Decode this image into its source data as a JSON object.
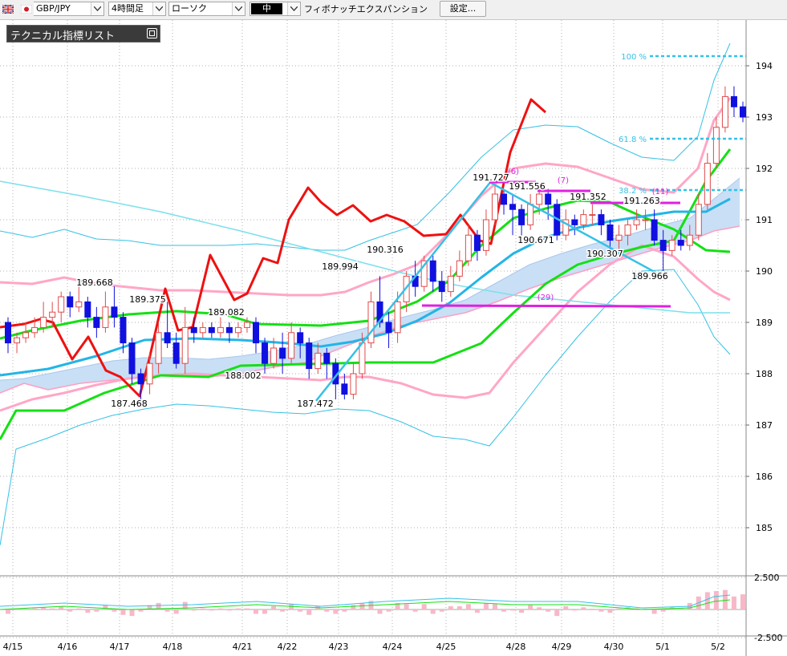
{
  "toolbar": {
    "symbol": "GBP/JPY",
    "timeframe": "4時間足",
    "chart_type": "ローソク",
    "size": "中",
    "analysis": "フィボナッチエクスパンション",
    "settings_label": "設定..."
  },
  "indicator_panel": {
    "title": "テクニカル指標リスト"
  },
  "chart": {
    "price_ticks": [
      "194",
      "193",
      "192",
      "191",
      "190",
      "189",
      "188",
      "187",
      "186",
      "185"
    ],
    "macd_ticks": [
      "2.500",
      "-2.500"
    ],
    "date_labels": [
      "4/15",
      "4/16",
      "4/17",
      "4/18",
      "4/21",
      "4/22",
      "4/23",
      "4/24",
      "4/25",
      "4/28",
      "4/29",
      "4/30",
      "5/1",
      "5/2"
    ],
    "price_annotations": [
      "189.668",
      "189.375",
      "189.082",
      "188.002",
      "187.468",
      "187.472",
      "189.994",
      "190.316",
      "191.727",
      "191.556",
      "190.671",
      "191.352",
      "191.263",
      "190.307",
      "189.966"
    ],
    "fib_levels": [
      "100 %",
      "61.8 %",
      "38.2 %"
    ],
    "wave_labels": [
      "(6)",
      "(7)",
      "(11)",
      "(29)"
    ]
  },
  "chart_data": {
    "type": "candlestick",
    "symbol": "GBP/JPY",
    "interval": "4時間足",
    "y_range": [
      184.3,
      194.6
    ],
    "candles": [
      [
        189.0,
        188.6,
        189.1,
        188.4
      ],
      [
        188.6,
        188.7,
        188.8,
        188.4
      ],
      [
        188.7,
        188.8,
        189.0,
        188.6
      ],
      [
        188.8,
        188.9,
        189.1,
        188.7
      ],
      [
        188.9,
        189.1,
        189.4,
        188.8
      ],
      [
        189.1,
        189.2,
        189.4,
        188.9
      ],
      [
        189.2,
        189.5,
        189.6,
        189.0
      ],
      [
        189.5,
        189.3,
        189.6,
        189.1
      ],
      [
        189.3,
        189.4,
        189.7,
        189.2
      ],
      [
        189.4,
        189.1,
        189.5,
        188.9
      ],
      [
        189.1,
        188.9,
        189.3,
        188.7
      ],
      [
        188.9,
        189.3,
        189.6,
        188.8
      ],
      [
        189.3,
        189.1,
        189.7,
        188.9
      ],
      [
        189.1,
        188.6,
        189.2,
        188.4
      ],
      [
        188.6,
        188.0,
        188.7,
        187.8
      ],
      [
        188.0,
        187.8,
        188.1,
        187.5
      ],
      [
        187.8,
        188.2,
        188.4,
        187.6
      ],
      [
        188.2,
        188.8,
        189.0,
        188.0
      ],
      [
        188.8,
        188.6,
        189.4,
        188.5
      ],
      [
        188.6,
        188.2,
        188.8,
        188.1
      ],
      [
        188.2,
        188.9,
        189.3,
        188.0
      ],
      [
        188.9,
        188.8,
        189.1,
        188.6
      ],
      [
        188.8,
        188.9,
        189.0,
        188.7
      ],
      [
        188.9,
        188.8,
        189.0,
        188.7
      ],
      [
        188.8,
        188.9,
        189.1,
        188.7
      ],
      [
        188.9,
        188.8,
        189.0,
        188.6
      ],
      [
        188.8,
        188.9,
        189.0,
        188.7
      ],
      [
        188.9,
        189.0,
        189.1,
        188.8
      ],
      [
        189.0,
        188.6,
        189.1,
        188.4
      ],
      [
        188.6,
        188.2,
        188.7,
        188.0
      ],
      [
        188.2,
        188.5,
        188.7,
        188.1
      ],
      [
        188.5,
        188.3,
        188.8,
        188.0
      ],
      [
        188.3,
        188.8,
        189.0,
        188.2
      ],
      [
        188.8,
        188.6,
        188.9,
        188.3
      ],
      [
        188.6,
        188.1,
        188.7,
        187.9
      ],
      [
        188.1,
        188.4,
        188.6,
        188.0
      ],
      [
        188.4,
        188.2,
        188.5,
        187.9
      ],
      [
        188.2,
        187.8,
        188.3,
        187.5
      ],
      [
        187.8,
        187.6,
        188.0,
        187.5
      ],
      [
        187.6,
        188.0,
        188.2,
        187.5
      ],
      [
        188.0,
        188.6,
        188.8,
        187.9
      ],
      [
        188.6,
        189.4,
        189.6,
        188.5
      ],
      [
        189.4,
        189.0,
        189.9,
        188.9
      ],
      [
        189.0,
        188.8,
        189.2,
        188.5
      ],
      [
        188.8,
        189.4,
        189.6,
        188.6
      ],
      [
        189.4,
        189.9,
        190.0,
        189.2
      ],
      [
        189.9,
        189.7,
        190.2,
        189.5
      ],
      [
        189.7,
        190.2,
        190.3,
        189.6
      ],
      [
        190.2,
        189.8,
        190.3,
        189.6
      ],
      [
        189.8,
        189.6,
        190.0,
        189.4
      ],
      [
        189.6,
        189.9,
        190.1,
        189.5
      ],
      [
        189.9,
        190.2,
        190.4,
        189.8
      ],
      [
        190.2,
        190.7,
        190.9,
        190.1
      ],
      [
        190.7,
        190.4,
        190.8,
        190.2
      ],
      [
        190.4,
        191.0,
        191.2,
        190.3
      ],
      [
        191.0,
        191.5,
        191.7,
        190.9
      ],
      [
        191.5,
        191.3,
        191.6,
        191.1
      ],
      [
        191.3,
        191.2,
        191.5,
        190.7
      ],
      [
        191.2,
        190.9,
        191.3,
        190.6
      ],
      [
        190.9,
        191.3,
        191.5,
        190.8
      ],
      [
        191.3,
        191.5,
        191.6,
        191.1
      ],
      [
        191.5,
        191.3,
        191.6,
        191.0
      ],
      [
        191.3,
        190.7,
        191.4,
        190.6
      ],
      [
        190.7,
        191.0,
        191.2,
        190.6
      ],
      [
        191.0,
        190.9,
        191.1,
        190.7
      ],
      [
        190.9,
        191.1,
        191.2,
        190.8
      ],
      [
        191.1,
        191.1,
        191.3,
        190.9
      ],
      [
        191.1,
        190.9,
        191.2,
        190.7
      ],
      [
        190.9,
        190.6,
        191.0,
        190.3
      ],
      [
        190.6,
        190.7,
        190.9,
        190.4
      ],
      [
        190.7,
        190.9,
        191.0,
        190.5
      ],
      [
        190.9,
        191.0,
        191.2,
        190.8
      ],
      [
        191.0,
        191.0,
        191.2,
        190.8
      ],
      [
        191.0,
        190.6,
        191.2,
        190.5
      ],
      [
        190.6,
        190.4,
        190.8,
        190.0
      ],
      [
        190.4,
        190.6,
        190.7,
        190.3
      ],
      [
        190.6,
        190.5,
        190.8,
        190.4
      ],
      [
        190.5,
        190.7,
        190.9,
        190.4
      ],
      [
        190.7,
        191.3,
        191.5,
        190.6
      ],
      [
        191.3,
        192.1,
        192.3,
        191.2
      ],
      [
        192.1,
        192.8,
        193.0,
        192.0
      ],
      [
        192.8,
        193.4,
        193.6,
        192.7
      ],
      [
        193.4,
        193.2,
        193.6,
        193.0
      ],
      [
        193.2,
        193.0,
        193.3,
        192.9
      ]
    ],
    "fibonacci_expansion": {
      "point_a": 187.472,
      "point_b": 191.727,
      "point_c": 189.966,
      "levels_pct": [
        38.2,
        61.8,
        100
      ]
    }
  },
  "colors": {
    "up_candle": "#e24a4a",
    "down_candle": "#1010e0",
    "kumo": "#c9dff5",
    "bollinger": "#ffa6c6",
    "fib": "#36c1e6"
  }
}
